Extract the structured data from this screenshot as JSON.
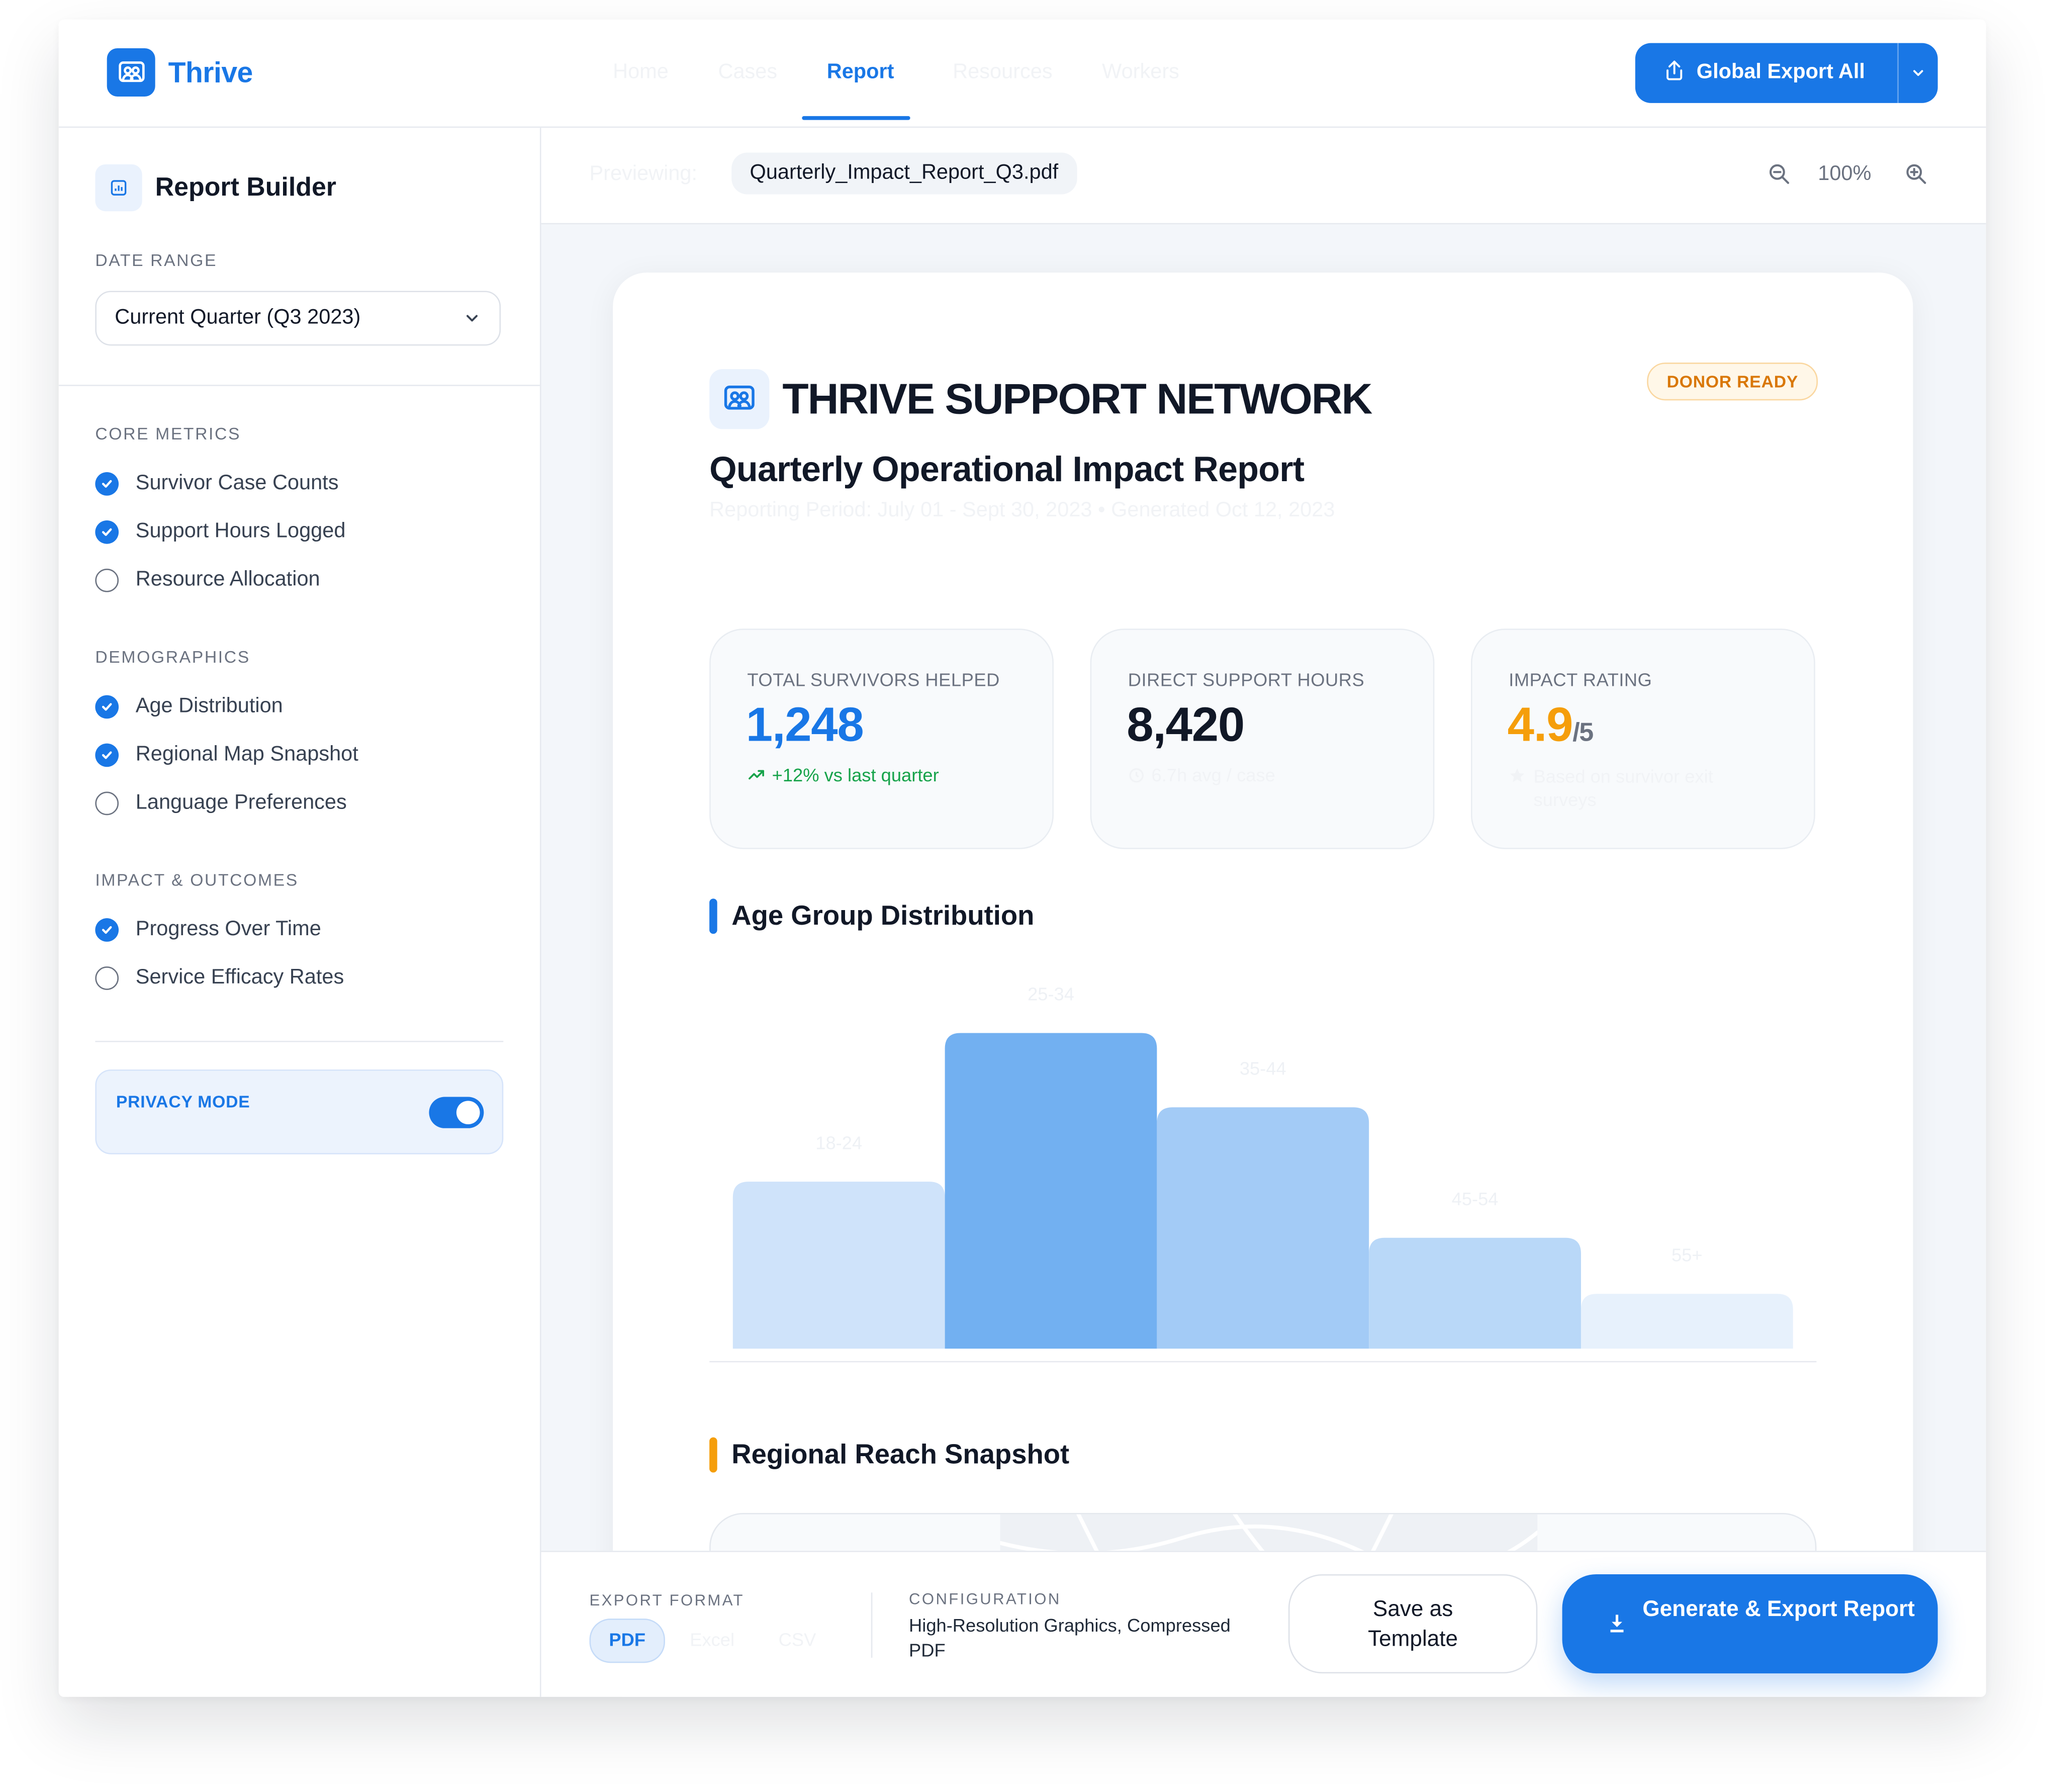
{
  "app": {
    "name": "Thrive",
    "nav": [
      {
        "label": "Home"
      },
      {
        "label": "Cases"
      },
      {
        "label": "Report"
      },
      {
        "label": "Resources"
      },
      {
        "label": "Workers"
      }
    ],
    "global_export_label": "Global Export All"
  },
  "sidebar": {
    "title": "Report Builder",
    "date_range_label": "DATE RANGE",
    "date_range_value": "Current Quarter (Q3 2023)",
    "groups": [
      {
        "label": "CORE METRICS",
        "items": [
          {
            "label": "Survivor Case Counts",
            "checked": true
          },
          {
            "label": "Support Hours Logged",
            "checked": true
          },
          {
            "label": "Resource Allocation",
            "checked": false
          }
        ]
      },
      {
        "label": "DEMOGRAPHICS",
        "items": [
          {
            "label": "Age Distribution",
            "checked": true
          },
          {
            "label": "Regional Map Snapshot",
            "checked": true
          },
          {
            "label": "Language Preferences",
            "checked": false
          }
        ]
      },
      {
        "label": "IMPACT & OUTCOMES",
        "items": [
          {
            "label": "Progress Over Time",
            "checked": true
          },
          {
            "label": "Service Efficacy Rates",
            "checked": false
          }
        ]
      }
    ],
    "privacy_mode_label": "PRIVACY MODE",
    "privacy_mode_on": true
  },
  "preview": {
    "label": "Previewing:",
    "filename": "Quarterly_Impact_Report_Q3.pdf",
    "zoom": "100%"
  },
  "report": {
    "org_name": "THRIVE SUPPORT NETWORK",
    "badge": "DONOR READY",
    "title": "Quarterly Operational Impact Report",
    "meta": "Reporting Period: July 01 - Sept 30, 2023 • Generated Oct 12, 2023",
    "stats": [
      {
        "label": "TOTAL SURVIVORS HELPED",
        "value": "1,248",
        "suffix": "",
        "note": "+12% vs last quarter",
        "color": "#1977e6",
        "note_color": "#16a34a"
      },
      {
        "label": "DIRECT SUPPORT HOURS",
        "value": "8,420",
        "suffix": "",
        "note": "6.7h avg / case",
        "color": "#111827",
        "note_color": "#f1f3f6"
      },
      {
        "label": "IMPACT RATING",
        "value": "4.9",
        "suffix": "/5",
        "note": "Based on survivor exit surveys",
        "color": "#f59e0b",
        "note_color": "#f1f3f6"
      }
    ],
    "age_section_title": "Age Group Distribution",
    "region_section_title": "Regional Reach Snapshot"
  },
  "chart_data": {
    "type": "bar",
    "title": "Age Group Distribution",
    "categories": [
      "18-24",
      "25-34",
      "35-44",
      "45-54",
      "55+"
    ],
    "values": [
      128,
      242,
      185,
      85,
      42
    ],
    "ylim": [
      0,
      260
    ],
    "grid": false,
    "legend": "none",
    "colors": [
      "#cfe3fa",
      "#72b0f1",
      "#a3cbf6",
      "#b9d8f8",
      "#e7f1fc"
    ]
  },
  "export": {
    "format_label": "EXPORT FORMAT",
    "formats": [
      {
        "label": "PDF",
        "active": true
      },
      {
        "label": "Excel",
        "active": false
      },
      {
        "label": "CSV",
        "active": false
      }
    ],
    "config_label": "CONFIGURATION",
    "config_value": "High-Resolution Graphics, Compressed PDF",
    "save_template_label": "Save as Template",
    "generate_label": "Generate & Export Report"
  },
  "colors": {
    "primary": "#1977e6",
    "success": "#16a34a",
    "warning": "#f59e0b"
  },
  "icons": {
    "brand": "people-group-icon",
    "export": "share-export-icon",
    "report_builder": "bar-chart-icon",
    "zoom_out": "zoom-out-icon",
    "zoom_in": "zoom-in-icon",
    "generate": "download-icon"
  }
}
